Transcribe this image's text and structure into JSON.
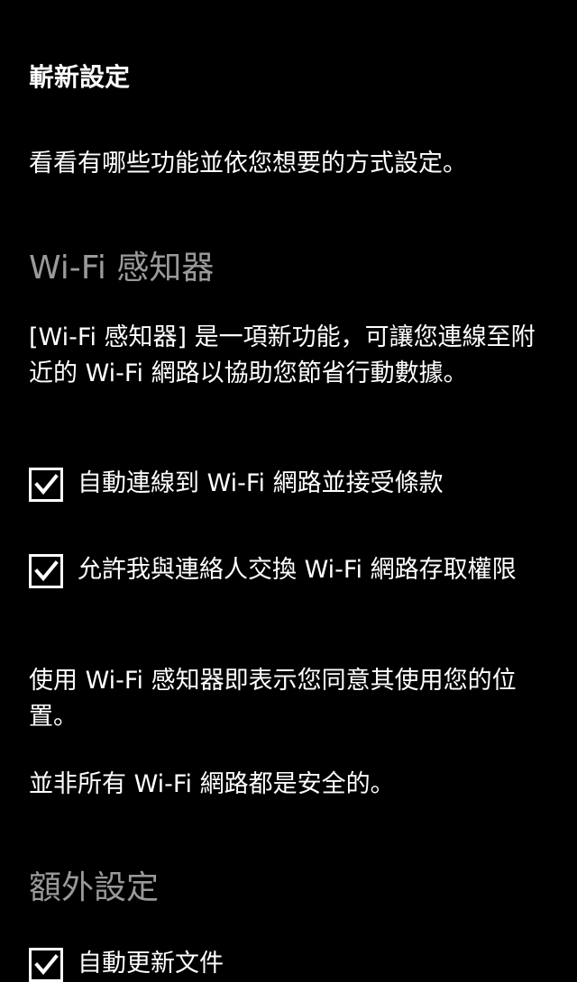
{
  "page": {
    "title": "嶄新設定",
    "intro": "看看有哪些功能並依您想要的方式設定。"
  },
  "wifi_sense": {
    "heading": "Wi-Fi 感知器",
    "description": "[Wi-Fi 感知器] 是一項新功能，可讓您連線至附近的 Wi-Fi 網路以協助您節省行動數據。",
    "options": [
      {
        "label": "自動連線到 Wi-Fi 網路並接受條款",
        "checked": true
      },
      {
        "label": "允許我與連絡人交換 Wi-Fi 網路存取權限",
        "checked": true
      }
    ],
    "location_notice": "使用 Wi-Fi 感知器即表示您同意其使用您的位置。",
    "security_notice": "並非所有 Wi-Fi 網路都是安全的。"
  },
  "extra_settings": {
    "heading": "額外設定",
    "options": [
      {
        "label": "自動更新文件",
        "checked": true
      }
    ]
  },
  "colors": {
    "background": "#000000",
    "text": "#ffffff",
    "heading": "#9a9a9a"
  },
  "icons": {
    "checkbox_checked": "checkmark-icon"
  }
}
